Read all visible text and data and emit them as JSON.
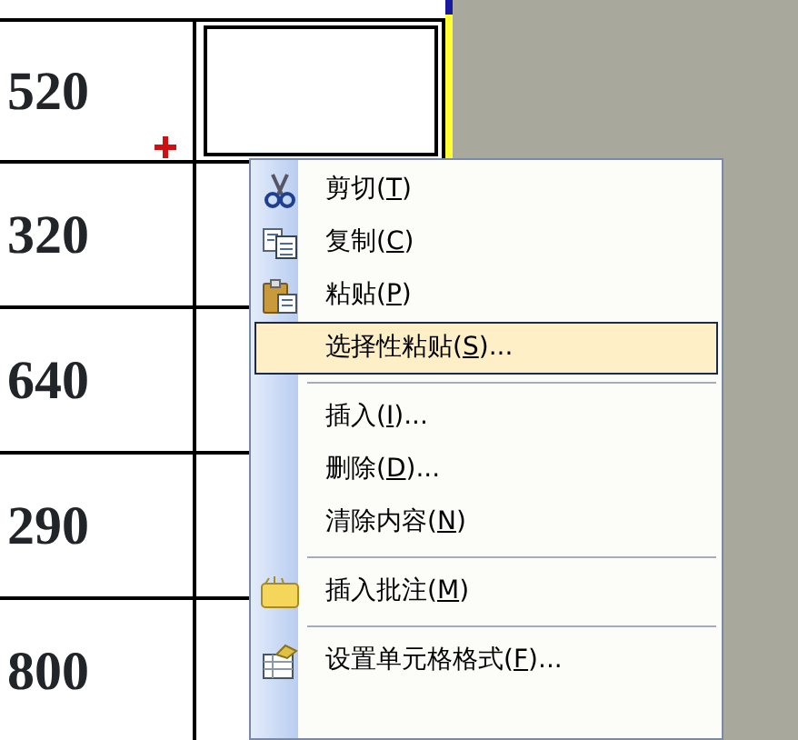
{
  "sheet": {
    "rows": [
      {
        "column_1": "520",
        "selected": true
      },
      {
        "column_1": "320",
        "selected": false
      },
      {
        "column_1": "640",
        "selected": false
      },
      {
        "column_1": "290",
        "selected": false
      },
      {
        "column_1": "800",
        "selected": false
      }
    ]
  },
  "context_menu": {
    "items": [
      {
        "kind": "item",
        "before": "剪切(",
        "key": "T",
        "after": ")",
        "selected": false
      },
      {
        "kind": "item",
        "before": "复制(",
        "key": "C",
        "after": ")",
        "selected": false
      },
      {
        "kind": "item",
        "before": "粘贴(",
        "key": "P",
        "after": ")",
        "selected": false
      },
      {
        "kind": "item",
        "before": "选择性粘贴(",
        "key": "S",
        "after": ")...",
        "selected": true
      },
      {
        "kind": "separator"
      },
      {
        "kind": "item",
        "before": "插入(",
        "key": "I",
        "after": ")...",
        "selected": false
      },
      {
        "kind": "item",
        "before": "删除(",
        "key": "D",
        "after": ")...",
        "selected": false
      },
      {
        "kind": "item",
        "before": "清除内容(",
        "key": "N",
        "after": ")",
        "selected": false
      },
      {
        "kind": "separator"
      },
      {
        "kind": "item",
        "before": "插入批注(",
        "key": "M",
        "after": ")",
        "selected": false
      },
      {
        "kind": "separator"
      },
      {
        "kind": "item",
        "before": "设置单元格格式(",
        "key": "F",
        "after": ")...",
        "selected": false
      }
    ]
  }
}
